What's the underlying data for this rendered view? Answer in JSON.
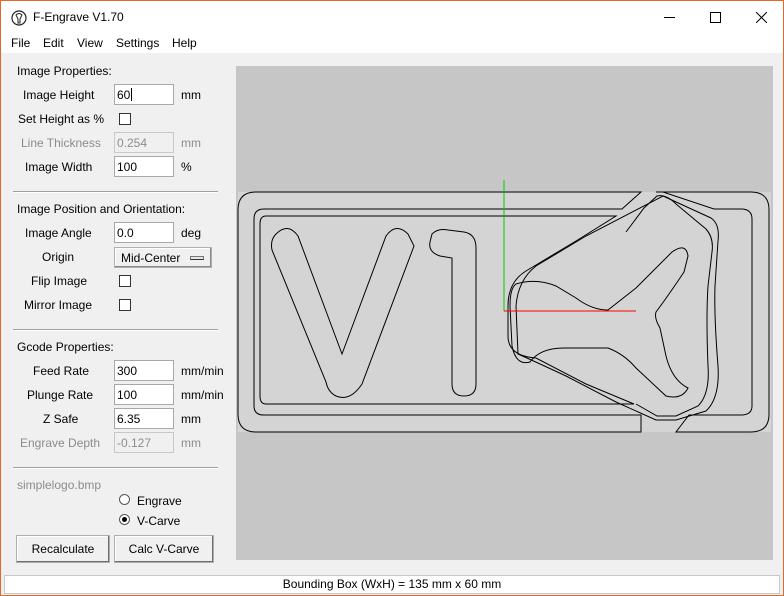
{
  "window": {
    "title": "F-Engrave V1.70"
  },
  "menu": {
    "file": "File",
    "edit": "Edit",
    "view": "View",
    "settings": "Settings",
    "help": "Help"
  },
  "image_properties": {
    "title": "Image Properties:",
    "height_label": "Image Height",
    "height_value": "60",
    "height_unit": "mm",
    "set_height_pct_label": "Set Height as %",
    "set_height_pct_checked": false,
    "line_thickness_label": "Line Thickness",
    "line_thickness_value": "0.254",
    "line_thickness_unit": "mm",
    "width_label": "Image Width",
    "width_value": "100",
    "width_unit": "%"
  },
  "position": {
    "title": "Image Position and Orientation:",
    "angle_label": "Image Angle",
    "angle_value": "0.0",
    "angle_unit": "deg",
    "origin_label": "Origin",
    "origin_value": "Mid-Center",
    "flip_label": "Flip Image",
    "flip_checked": false,
    "mirror_label": "Mirror Image",
    "mirror_checked": false
  },
  "gcode": {
    "title": "Gcode Properties:",
    "feed_label": "Feed Rate",
    "feed_value": "300",
    "feed_unit": "mm/min",
    "plunge_label": "Plunge Rate",
    "plunge_value": "100",
    "plunge_unit": "mm/min",
    "zsafe_label": "Z Safe",
    "zsafe_value": "6.35",
    "zsafe_unit": "mm",
    "depth_label": "Engrave Depth",
    "depth_value": "-0.127",
    "depth_unit": "mm"
  },
  "file": {
    "name": "simplelogo.bmp"
  },
  "mode": {
    "engrave_label": "Engrave",
    "vcarve_label": "V-Carve",
    "selected": "V-Carve"
  },
  "buttons": {
    "recalculate": "Recalculate",
    "calc_vcarve": "Calc V-Carve"
  },
  "status": {
    "text": "Bounding Box (WxH) = 135 mm  x 60 mm"
  },
  "colors": {
    "x_axis": "#ff0000",
    "y_axis": "#00cc00",
    "canvas_bg": "#c6c6c6",
    "window_border": "#e06a2a"
  }
}
